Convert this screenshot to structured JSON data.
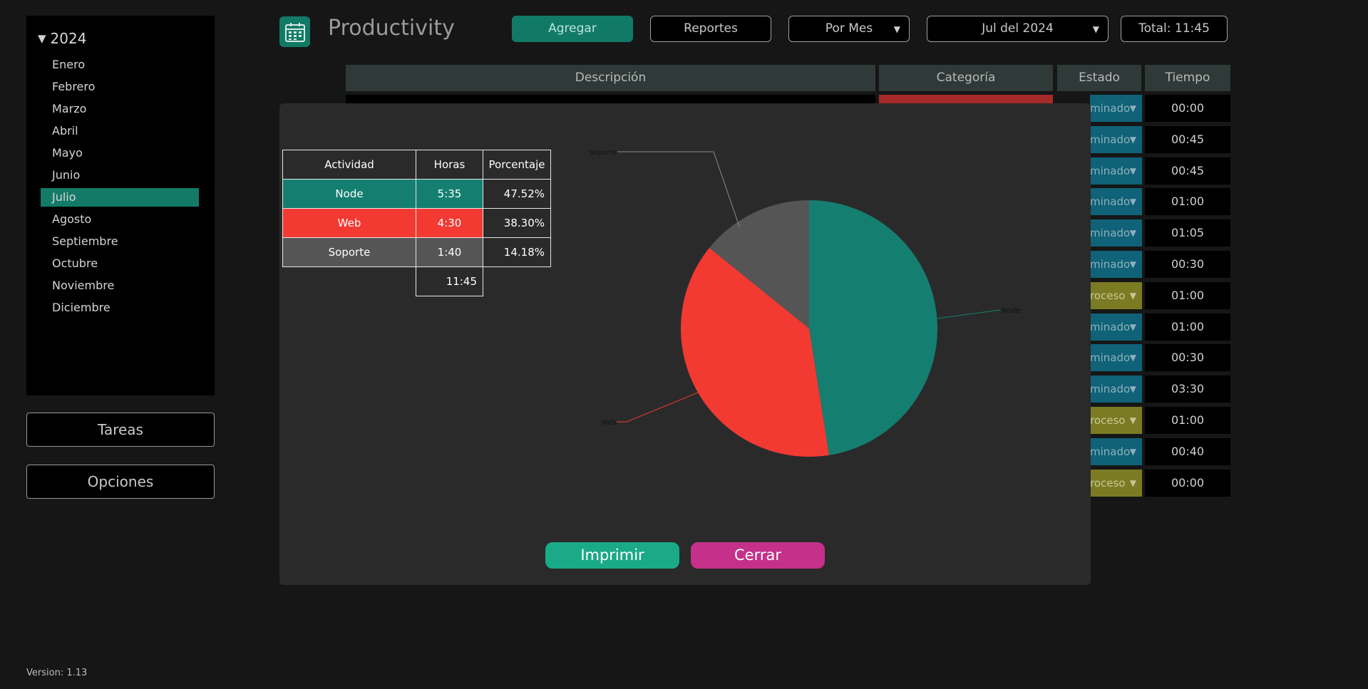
{
  "sidebar": {
    "year": "2024",
    "months": [
      "Enero",
      "Febrero",
      "Marzo",
      "Abril",
      "Mayo",
      "Junio",
      "Julio",
      "Agosto",
      "Septiembre",
      "Octubre",
      "Noviembre",
      "Diciembre"
    ],
    "active_month": "Julio",
    "tasks_label": "Tareas",
    "options_label": "Opciones",
    "version": "Version: 1.13"
  },
  "header": {
    "title": "Productivity",
    "add_label": "Agregar",
    "reports_label": "Reportes",
    "period_label": "Por Mes",
    "month_label": "Jul del 2024",
    "total_label": "Total: 11:45"
  },
  "table": {
    "columns": [
      "Descripción",
      "Categoría",
      "Estado",
      "Tiempo"
    ],
    "rows": [
      {
        "estado": "minado",
        "kind": "done",
        "tiempo": "00:00"
      },
      {
        "estado": "minado",
        "kind": "done",
        "tiempo": "00:45"
      },
      {
        "estado": "minado",
        "kind": "done",
        "tiempo": "00:45"
      },
      {
        "estado": "minado",
        "kind": "done",
        "tiempo": "01:00"
      },
      {
        "estado": "minado",
        "kind": "done",
        "tiempo": "01:05"
      },
      {
        "estado": "minado",
        "kind": "done",
        "tiempo": "00:30"
      },
      {
        "estado": "roceso",
        "kind": "proc",
        "tiempo": "01:00"
      },
      {
        "estado": "minado",
        "kind": "done",
        "tiempo": "01:00"
      },
      {
        "estado": "minado",
        "kind": "done",
        "tiempo": "00:30"
      },
      {
        "estado": "minado",
        "kind": "done",
        "tiempo": "03:30"
      },
      {
        "estado": "roceso",
        "kind": "proc",
        "tiempo": "01:00"
      },
      {
        "estado": "minado",
        "kind": "done",
        "tiempo": "00:40"
      },
      {
        "estado": "roceso",
        "kind": "proc",
        "tiempo": "00:00"
      }
    ]
  },
  "report": {
    "headers": {
      "actividad": "Actividad",
      "horas": "Horas",
      "porcentaje": "Porcentaje"
    },
    "rows": [
      {
        "actividad": "Node",
        "horas": "5:35",
        "porcentaje": "47.52%",
        "color": "#147f70"
      },
      {
        "actividad": "Web",
        "horas": "4:30",
        "porcentaje": "38.30%",
        "color": "#f23a33"
      },
      {
        "actividad": "Soporte",
        "horas": "1:40",
        "porcentaje": "14.18%",
        "color": "#555555"
      }
    ],
    "total": "11:45",
    "print_label": "Imprimir",
    "close_label": "Cerrar",
    "print_color": "#1aaa88",
    "close_color": "#c5308a"
  },
  "chart_data": {
    "type": "pie",
    "categories": [
      "Node",
      "Web",
      "Soporte"
    ],
    "values": [
      47.52,
      38.3,
      14.18
    ],
    "colors": [
      "#147f70",
      "#f23a33",
      "#555555"
    ]
  }
}
